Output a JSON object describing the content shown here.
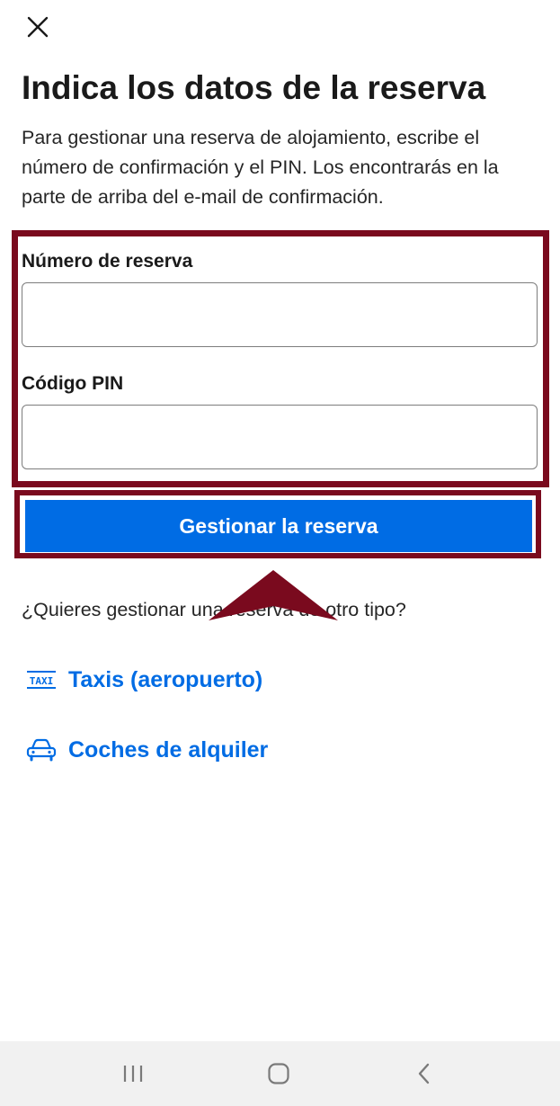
{
  "header": {
    "close_icon": "close-icon",
    "title": "Indica los datos de la reserva"
  },
  "intro": {
    "text": "Para gestionar una reserva de alojamiento, escribe el número de confirmación y el PIN. Los encontrarás en la parte de arriba del e-mail de confirmación."
  },
  "form": {
    "booking_number": {
      "label": "Número de reserva",
      "value": "",
      "placeholder": ""
    },
    "pin_code": {
      "label": "Código PIN",
      "value": "",
      "placeholder": ""
    },
    "submit_label": "Gestionar la reserva"
  },
  "other_bookings": {
    "question": "¿Quieres gestionar una reserva de otro tipo?",
    "links": [
      {
        "label": "Taxis (aeropuerto)",
        "icon": "taxi-icon"
      },
      {
        "label": "Coches de alquiler",
        "icon": "car-icon"
      }
    ]
  },
  "annotation": {
    "highlight_color": "#7a0a1e"
  },
  "colors": {
    "brand_blue": "#006ce4",
    "text": "#1a1a1a",
    "nav_background": "#f1f1f1"
  },
  "system_nav": {
    "recent_icon": "recent-apps-icon",
    "home_icon": "home-icon",
    "back_icon": "back-icon"
  }
}
